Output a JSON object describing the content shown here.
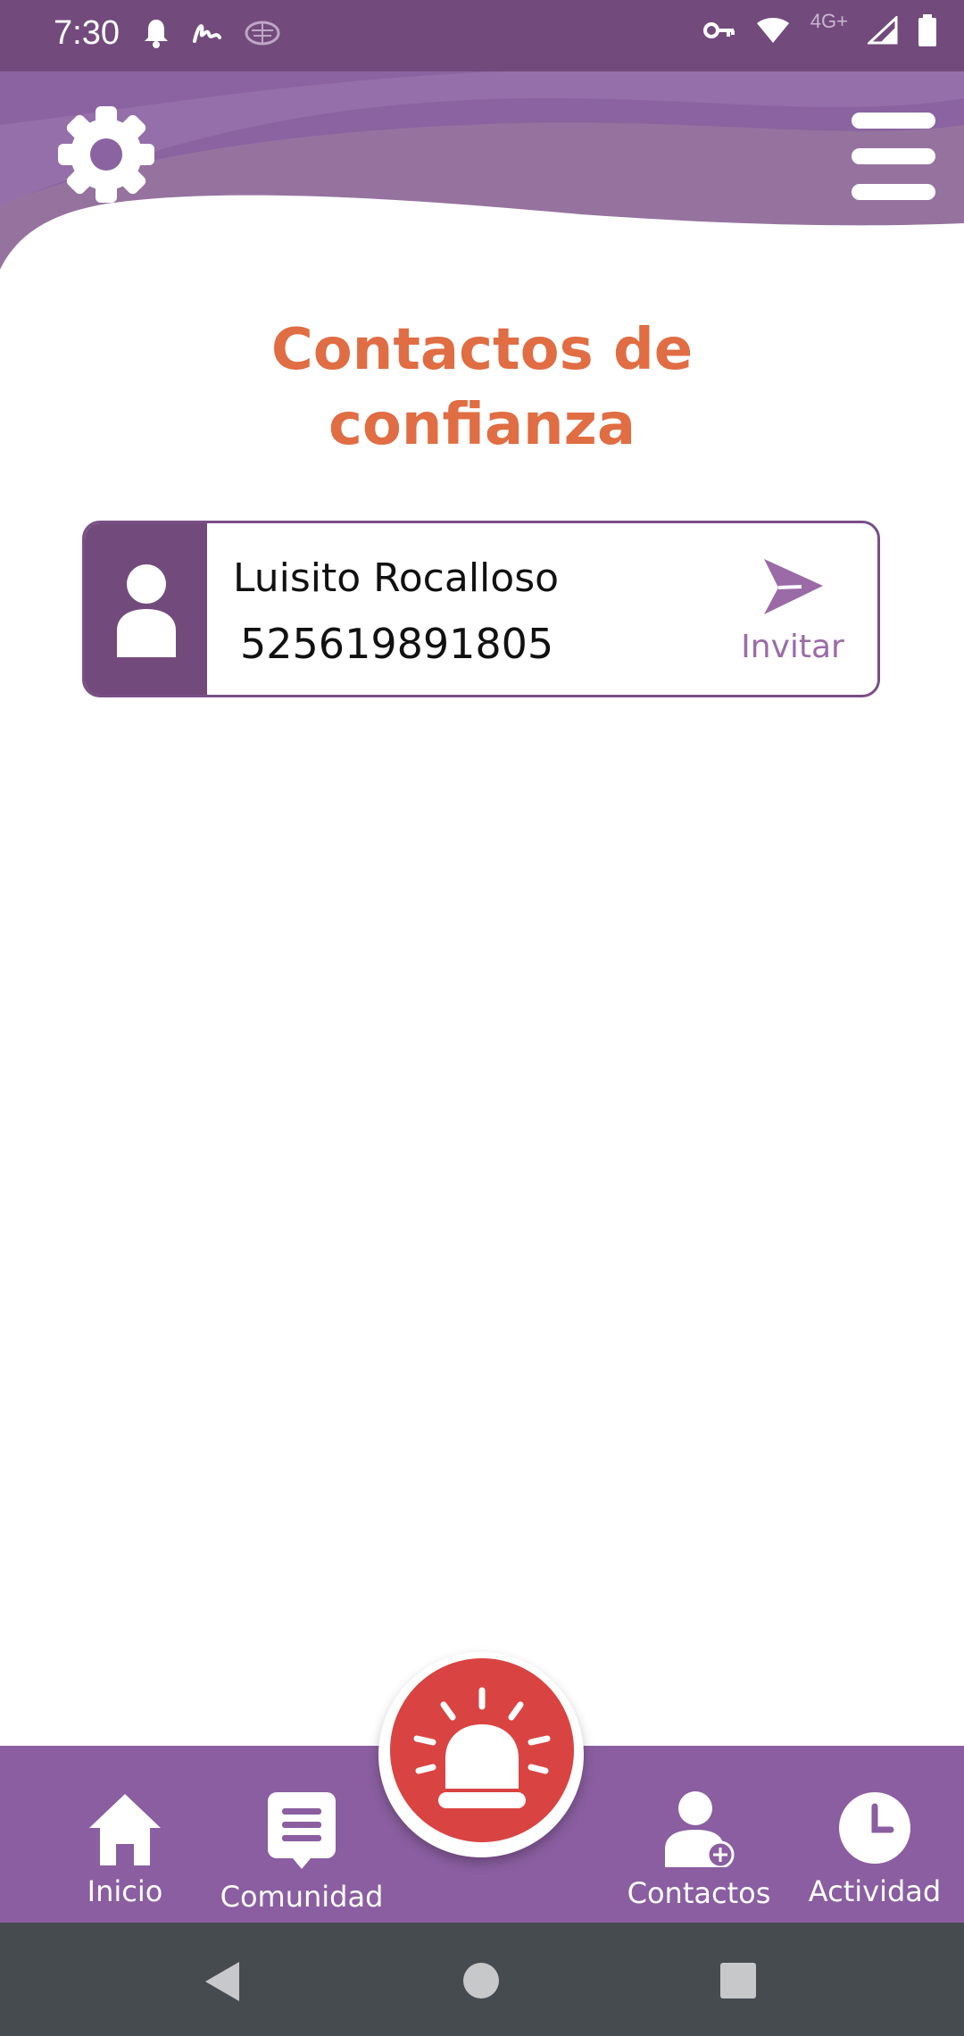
{
  "status_bar": {
    "time": "7:30",
    "left_icons": [
      "notification-bell-icon",
      "signature-icon",
      "brain-icon"
    ],
    "right_icons": [
      "vpn-key-icon",
      "wifi-icon",
      "signal-icon",
      "battery-icon"
    ],
    "network_label": "4G+"
  },
  "header": {
    "settings_icon": "gear-icon",
    "menu_icon": "hamburger-menu-icon"
  },
  "page": {
    "title_line1": "Contactos de",
    "title_line2": "confianza"
  },
  "contacts": [
    {
      "name": "Luisito Rocalloso",
      "phone": "525619891805",
      "action_label": "Invitar",
      "action_icon": "send-icon",
      "avatar_icon": "person-icon"
    }
  ],
  "bottom_nav": {
    "items": [
      {
        "label": "Inicio",
        "icon": "home-icon"
      },
      {
        "label": "Comunidad",
        "icon": "chat-icon"
      },
      {
        "label": "Contactos",
        "icon": "add-contact-icon"
      },
      {
        "label": "Actividad",
        "icon": "clock-icon"
      }
    ],
    "sos_icon": "alarm-siren-icon"
  },
  "system_nav": [
    "back-icon",
    "home-circle-icon",
    "recents-square-icon"
  ],
  "colors": {
    "primary": "#724b7c",
    "nav_bg": "#8a5ea0",
    "title": "#e06d43",
    "sos": "#d94442"
  }
}
